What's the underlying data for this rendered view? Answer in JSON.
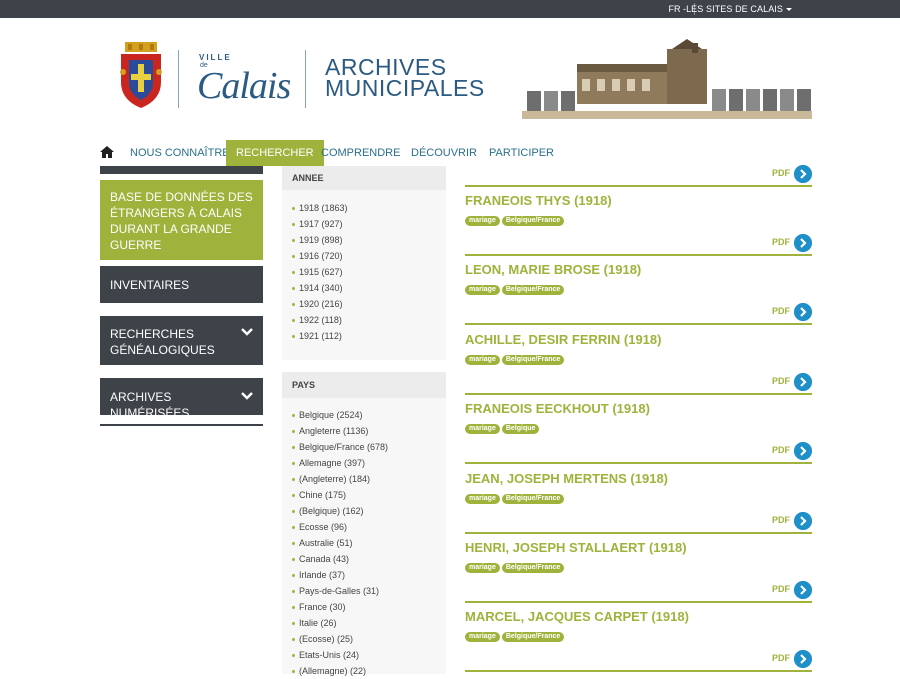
{
  "topbar": {
    "lang": "FR -",
    "sites": "LES SITES DE CALAIS"
  },
  "header": {
    "ville": "VILLE",
    "de": "de",
    "calais": "Calais",
    "archives_line1": "ARCHIVES",
    "archives_line2": "MUNICIPALES"
  },
  "nav": {
    "items": [
      "NOUS CONNAÎTRE",
      "RECHERCHER",
      "COMPRENDRE",
      "DÉCOUVRIR",
      "PARTICIPER"
    ],
    "active_index": 1
  },
  "sidebar": {
    "green_item": "BASE DE DONNÉES DES ÉTRANGERS À CALAIS DURANT LA GRANDE GUERRE",
    "items": [
      "INVENTAIRES",
      "RECHERCHES GÉNÉALOGIQUES",
      "ARCHIVES NUMÉRISÉES"
    ]
  },
  "facets": {
    "annee": {
      "title": "ANNEE",
      "items": [
        "1918 (1863)",
        "1917 (927)",
        "1919 (898)",
        "1916 (720)",
        "1915 (627)",
        "1914 (340)",
        "1920 (216)",
        "1922 (118)",
        "1921 (112)"
      ]
    },
    "pays": {
      "title": "PAYS",
      "items": [
        "Belgique (2524)",
        "Angleterre (1136)",
        "Belgique/France (678)",
        "Allemagne (397)",
        "(Angleterre) (184)",
        "Chine (175)",
        "(Belgique) (162)",
        "Ecosse (96)",
        "Australie (51)",
        "Canada (43)",
        "Irlande (37)",
        "Pays-de-Galles (31)",
        "France (30)",
        "Italie (26)",
        "(Ecosse) (25)",
        "Etats-Unis (24)",
        "(Allemagne) (22)"
      ]
    }
  },
  "results": {
    "pdf_label": "PDF",
    "items": [
      {
        "title": "FRANEOIS THYS (1918)",
        "tags": [
          "mariage",
          "Belgique/France"
        ]
      },
      {
        "title": "LEON, MARIE BROSE (1918)",
        "tags": [
          "mariage",
          "Belgique/France"
        ]
      },
      {
        "title": "ACHILLE, DESIR FERRIN (1918)",
        "tags": [
          "mariage",
          "Belgique/France"
        ]
      },
      {
        "title": "FRANEOIS EECKHOUT (1918)",
        "tags": [
          "mariage",
          "Belgique"
        ]
      },
      {
        "title": "JEAN, JOSEPH MERTENS (1918)",
        "tags": [
          "mariage",
          "Belgique/France"
        ]
      },
      {
        "title": "HENRI, JOSEPH STALLAERT (1918)",
        "tags": [
          "mariage",
          "Belgique/France"
        ]
      },
      {
        "title": "MARCEL, JACQUES CARPET (1918)",
        "tags": [
          "mariage",
          "Belgique/France"
        ]
      }
    ]
  },
  "colors": {
    "accent_green": "#9fb33c",
    "dark": "#3d4348",
    "blue": "#2b5a82",
    "pdf_blue": "#1e8fc9"
  },
  "icons": {
    "home": "home-icon",
    "chevron": "chevron-down-icon",
    "arrow": "arrow-right-icon",
    "caret": "caret-down-icon"
  }
}
